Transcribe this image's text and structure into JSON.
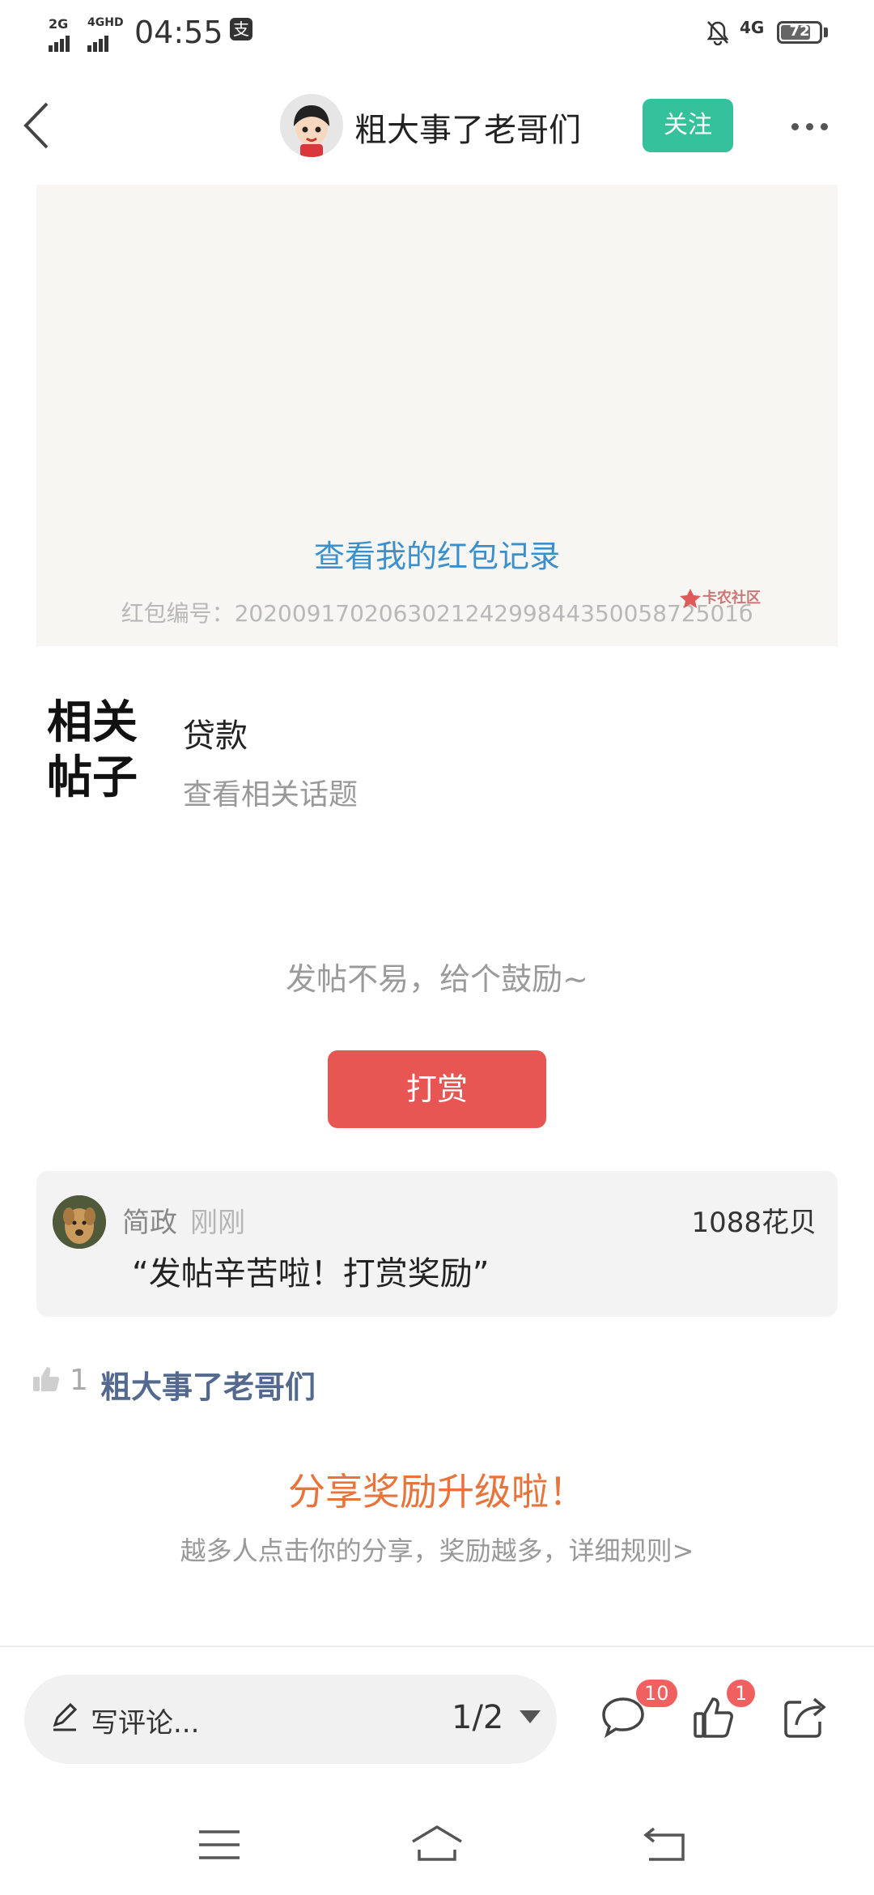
{
  "status_bar": {
    "signal_1": "2G",
    "signal_2": "4GHD",
    "time": "04:55",
    "network": "4G",
    "battery": "72"
  },
  "header": {
    "author_name": "粗大事了老哥们",
    "follow_label": "关注",
    "icons": [
      "back-icon",
      "more-icon"
    ]
  },
  "red_packet": {
    "link_text": "查看我的红包记录",
    "serial_text": "红包编号：20200917020630212429984435005872501б",
    "watermark": "卡农社区"
  },
  "related": {
    "title": "相关帖子",
    "tag": "贷款",
    "topic_link": "查看相关话题"
  },
  "reward": {
    "encourage_text": "发帖不易，给个鼓励~",
    "button_label": "打赏",
    "record": {
      "tipper_name": "简政",
      "time": "刚刚",
      "amount": "1088花贝",
      "message": "“发帖辛苦啦！打赏奖励”"
    }
  },
  "likes": {
    "count": "1",
    "liker_name": "粗大事了老哥们"
  },
  "share": {
    "title": "分享奖励升级啦！",
    "desc": "越多人点击你的分享，奖励越多，详细规则>"
  },
  "bottom_bar": {
    "comment_placeholder": "写评论...",
    "page_indicator": "1/2",
    "comments_badge": "10",
    "likes_badge": "1"
  },
  "colors": {
    "follow_green": "#36c19d",
    "reward_red": "#e85654",
    "link_blue": "#3b8fcb",
    "share_orange": "#e8743c",
    "liker_blue": "#54698e"
  }
}
